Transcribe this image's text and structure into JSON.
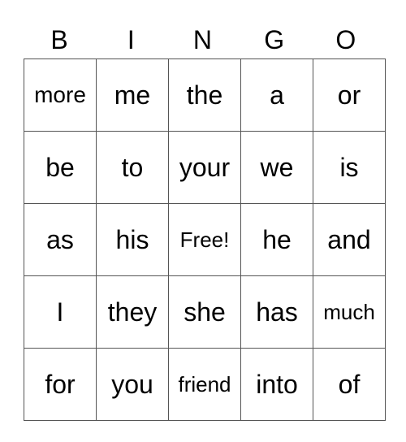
{
  "header": [
    "B",
    "I",
    "N",
    "G",
    "O"
  ],
  "rows": [
    [
      "more",
      "me",
      "the",
      "a",
      "or"
    ],
    [
      "be",
      "to",
      "your",
      "we",
      "is"
    ],
    [
      "as",
      "his",
      "Free!",
      "he",
      "and"
    ],
    [
      "I",
      "they",
      "she",
      "has",
      "much"
    ],
    [
      "for",
      "you",
      "friend",
      "into",
      "of"
    ]
  ]
}
